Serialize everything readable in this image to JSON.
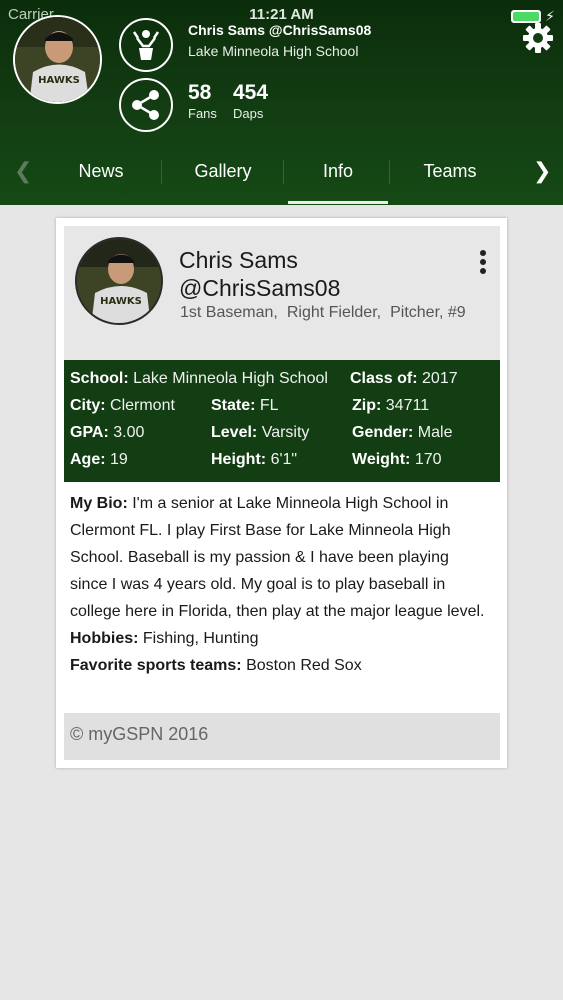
{
  "status_bar": {
    "carrier": "Carrier",
    "time": "11:21 AM",
    "battery_level": 1.0
  },
  "header": {
    "name_handle": "Chris Sams @ChrisSams08",
    "school": "Lake Minneola High School",
    "fans_count": "58",
    "fans_label": "Fans",
    "daps_count": "454",
    "daps_label": "Daps",
    "icons": [
      "trophy-icon",
      "share-icon",
      "gear-icon"
    ]
  },
  "tabs": [
    "News",
    "Gallery",
    "Info",
    "Teams"
  ],
  "active_tab": "Info",
  "profile": {
    "name": "Chris Sams",
    "handle": "@ChrisSams08",
    "positions": [
      "1st Baseman,",
      "Right Fielder,",
      "Pitcher, #9"
    ]
  },
  "details": {
    "school_label": "School:",
    "school": "Lake Minneola High School",
    "class_label": "Class of:",
    "class": "2017",
    "city_label": "City:",
    "city": "Clermont",
    "state_label": "State:",
    "state": "FL",
    "zip_label": "Zip:",
    "zip": "34711",
    "gpa_label": "GPA:",
    "gpa": "3.00",
    "level_label": "Level:",
    "level": "Varsity",
    "gender_label": "Gender:",
    "gender": "Male",
    "age_label": "Age:",
    "age": "19",
    "height_label": "Height:",
    "height": "6'1\"",
    "weight_label": "Weight:",
    "weight": "170"
  },
  "bio": {
    "bio_label": "My Bio:",
    "bio_text": "I'm a senior at Lake Minneola High School in Clermont FL. I play First Base for Lake Minneola High School. Baseball is my passion & I have been playing since I was 4 years old. My goal is to play baseball in college here in Florida, then play at the major league level.",
    "hobbies_label": "Hobbies:",
    "hobbies": "Fishing, Hunting",
    "teams_label": "Favorite sports teams:",
    "teams": "Boston Red Sox"
  },
  "footer": "© myGSPN 2016",
  "colors": {
    "header_green": "#133d13",
    "details_green": "#133d13",
    "background": "#e6e6e6"
  }
}
